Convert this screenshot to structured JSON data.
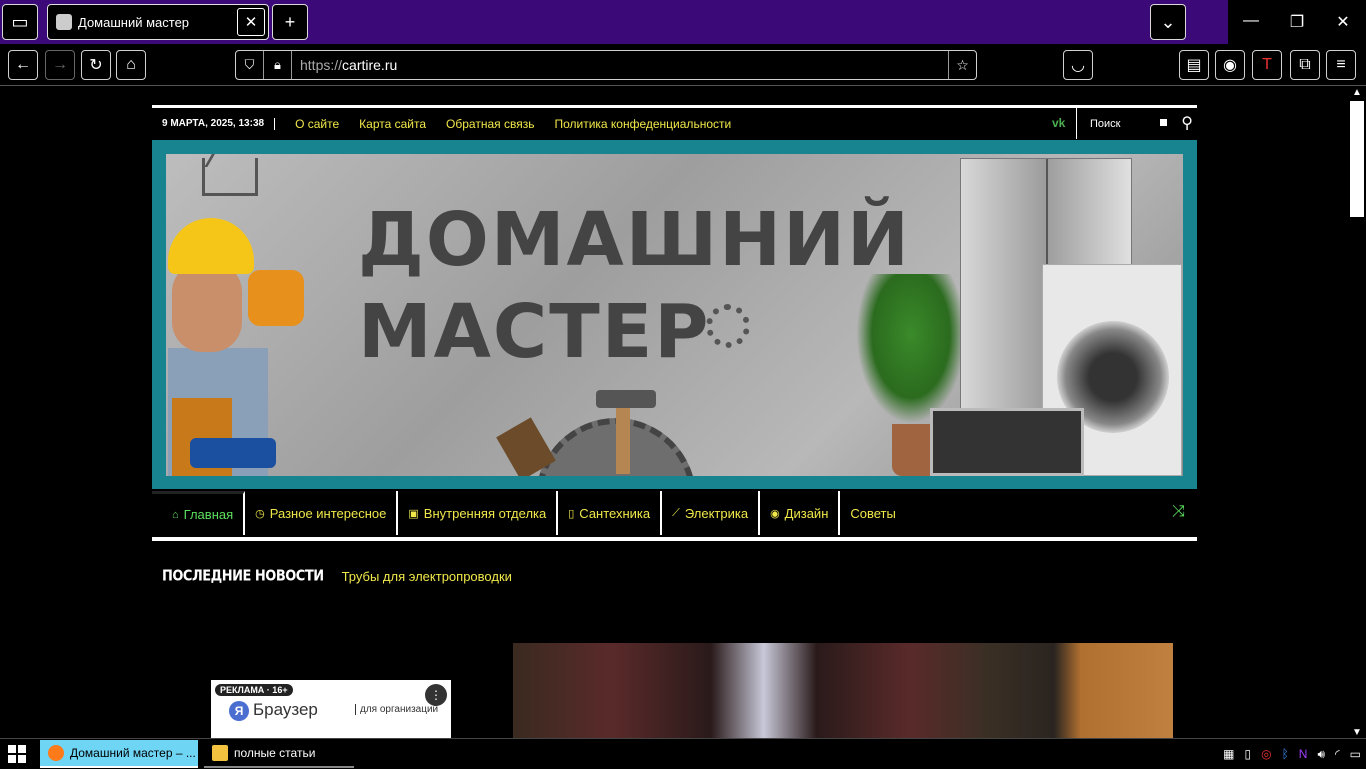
{
  "browser": {
    "tab_title": "Домашний мастер",
    "tab_close": "✕",
    "new_tab": "+",
    "url_protocol": "https://",
    "url_host": "cartire.ru"
  },
  "site": {
    "date": "9 МАРТА, 2025, 13:38",
    "top_links": [
      "О сайте",
      "Карта сайта",
      "Обратная связь",
      "Политика конфеденциальности"
    ],
    "vk_label": "vk",
    "search_placeholder": "Поиск",
    "banner_title_line1": "ДОМАШНИЙ",
    "banner_title_line2": "МАСТЕР",
    "menu": [
      {
        "label": "Главная",
        "icon": "home-icon",
        "glyph": "⌂"
      },
      {
        "label": "Разное интересное",
        "icon": "clock-icon",
        "glyph": "◷"
      },
      {
        "label": "Внутренняя отделка",
        "icon": "briefcase-icon",
        "glyph": "▣"
      },
      {
        "label": "Сантехника",
        "icon": "file-icon",
        "glyph": "▯"
      },
      {
        "label": "Электрика",
        "icon": "chart-icon",
        "glyph": "⟋"
      },
      {
        "label": "Дизайн",
        "icon": "eye-icon",
        "glyph": "◉"
      },
      {
        "label": "Советы",
        "icon": "",
        "glyph": ""
      }
    ],
    "news_label": "ПОСЛЕДНИЕ НОВОСТИ",
    "news_item": "Трубы для электропроводки"
  },
  "ad": {
    "badge": "РЕКЛАМА · 16+",
    "brand": "Браузер",
    "logo_letter": "Я",
    "org": "для организаций"
  },
  "taskbar": {
    "items": [
      "Домашний мастер – ...",
      "полные статьи"
    ]
  },
  "colors": {
    "accent_yellow": "#f0e84a",
    "accent_green": "#5ce05c",
    "banner_teal": "#17848f",
    "tabbar_purple": "#3b0a78"
  }
}
